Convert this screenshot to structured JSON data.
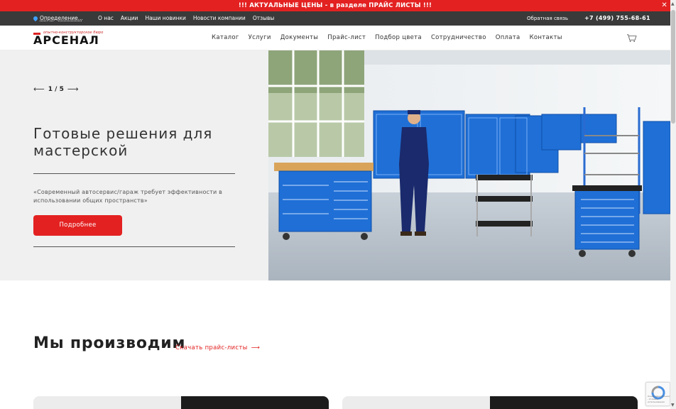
{
  "promo": {
    "text": "!!! АКТУАЛЬНЫЕ ЦЕНЫ - в разделе ПРАЙС ЛИСТЫ !!!",
    "close": "✕"
  },
  "topbar": {
    "location": "Определение...",
    "links": [
      "О нас",
      "Акции",
      "Наши новинки",
      "Новости компании",
      "Отзывы"
    ],
    "feedback": "Обратная связь",
    "phone": "+7 (499) 755-68-61"
  },
  "header": {
    "logo_small": "опытно-конструкторское бюро",
    "logo_big": "АРСЕНАЛ",
    "nav": [
      "Каталог",
      "Услуги",
      "Документы",
      "Прайс-лист",
      "Подбор цвета",
      "Сотрудничество",
      "Оплата",
      "Контакты"
    ],
    "cart_icon": "cart-icon"
  },
  "hero": {
    "slide_counter": "1 / 5",
    "prev_arrow": "⟵",
    "next_arrow": "⟶",
    "title": "Готовые решения для мастерской",
    "description": "«Современный автосервис/гараж требует эффективности в использовании общих пространств»",
    "button": "Подробнее"
  },
  "section": {
    "title": "Мы производим",
    "download": "Скачать прайс-листы",
    "download_arrow": "⟶"
  },
  "recaptcha": {
    "text": "Конфиденциальность - Условия использования"
  },
  "colors": {
    "accent": "#e32121",
    "topbar": "#3a3a3a",
    "hero_bg": "#f0f0f0",
    "furniture_blue": "#1f6fd6"
  }
}
